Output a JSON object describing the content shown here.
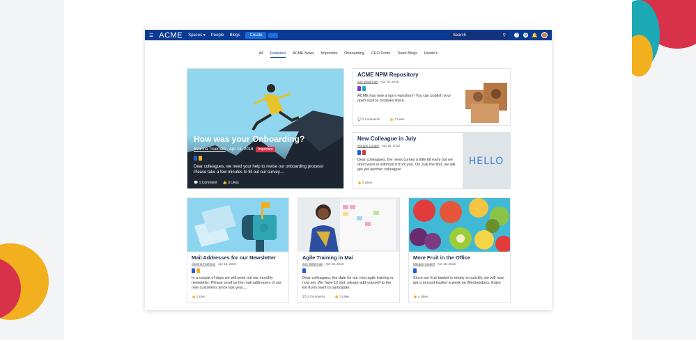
{
  "nav": {
    "logo": "ACME",
    "items": [
      "Spaces",
      "People",
      "Blogs"
    ],
    "create": "Create",
    "more": "···",
    "search_placeholder": "Search"
  },
  "tabs": [
    "All",
    "Featured",
    "ACME News",
    "Important",
    "Onboarding",
    "CEO Posts",
    "Team Blogs",
    "Howto's"
  ],
  "hero": {
    "title": "How was your Onboarding?",
    "author": "Svanna Trueman",
    "date": "Apr 18, 2018",
    "badge": "Important",
    "desc": "Dear colleagues, we need your help to revise our onboarding process! Please take a few minutes to fill out our survey....",
    "comments": "1 Comment",
    "likes": "3 Likes"
  },
  "npm": {
    "title": "ACME NPM Repository",
    "author": "Zoe Waterman",
    "date": "Apr 18, 2018",
    "desc": "ACME has now a npm repository! You can publish your open source modules there.",
    "comments": "2 Comments",
    "likes": "3 Likes"
  },
  "colleague": {
    "title": "New Colleague in July",
    "author": "Morgan Cooper",
    "date": "Apr 18, 2018",
    "desc": "Dear colleagues, the news comes a little bit early but we don't want to withhold it from you. On July the first, we will get yet another colleague!",
    "likes": "4 Likes",
    "hello": "HELLO"
  },
  "mail": {
    "title": "Mail Addresses for our Newsletter",
    "author": "Svanna Trueman",
    "date": "Apr 18, 2018",
    "desc": "In a couple of days we will send out our monthly newsletter. Please send us the mail addresses of our new customers since last year,...",
    "likes": "1 Like"
  },
  "agile": {
    "title": "Agile Training in Mai",
    "author": "Zoe Waterman",
    "date": "Apr 18, 2018",
    "desc": "Dear colleagues, the date for our next agile training is now set. We have 12 slot, please add yourself to the list if you want to participate.",
    "comments": "2 Comments",
    "likes": "3 Likes"
  },
  "fruit": {
    "title": "More Fruit in the Office",
    "author": "Morgan Cooper",
    "date": "Apr 18, 2018",
    "desc": "Since our fruit basket is empty so quickly, we will now get a second basket a week on Wednesdays. Enjoy",
    "likes": "4 Likes"
  },
  "colors": {
    "nav": "#0b3a92",
    "badge": "#d8324a",
    "blue_tag": "#1f5fd6",
    "yellow_tag": "#f2b01e"
  }
}
